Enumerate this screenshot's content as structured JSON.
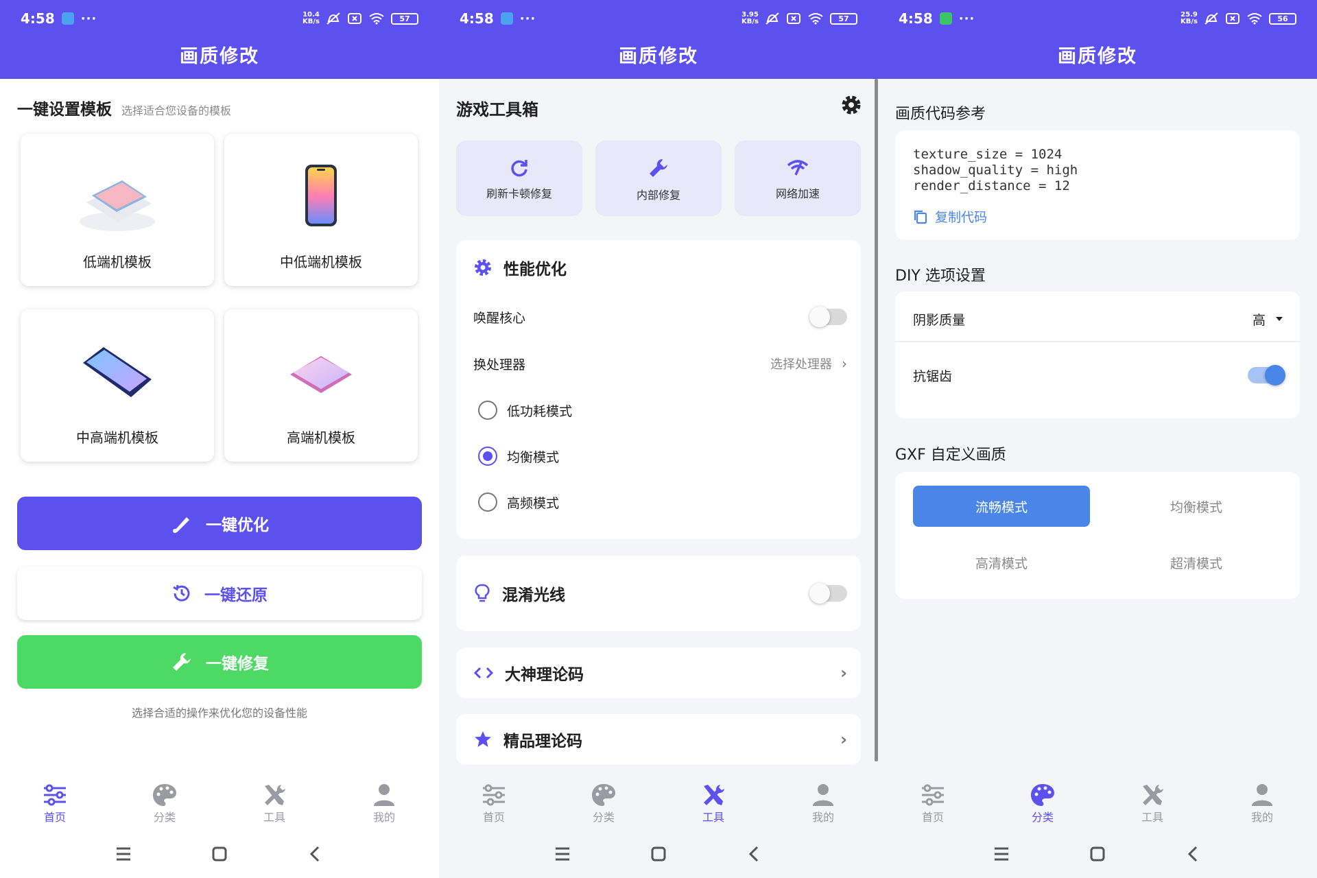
{
  "colors": {
    "primary": "#5c50ef",
    "green": "#4cd964",
    "blue": "#4a86e8"
  },
  "status_bars": [
    {
      "time": "4:58",
      "dots": "···",
      "speed_top": "10.4",
      "speed_bottom": "KB/s",
      "battery": "57"
    },
    {
      "time": "4:58",
      "dots": "···",
      "speed_top": "3.95",
      "speed_bottom": "KB/s",
      "battery": "57"
    },
    {
      "time": "4:58",
      "dots": "···",
      "speed_top": "25.9",
      "speed_bottom": "KB/s",
      "battery": "56"
    }
  ],
  "app_title": "画质修改",
  "home": {
    "section_title": "一键设置模板",
    "section_sub": "选择适合您设备的模板",
    "templates": [
      "低端机模板",
      "中低端机模板",
      "中高端机模板",
      "高端机模板"
    ],
    "optimize_label": "一键优化",
    "restore_label": "一键还原",
    "repair_label": "一键修复",
    "footnote": "选择合适的操作来优化您的设备性能"
  },
  "tools": {
    "title": "游戏工具箱",
    "quick_tools": [
      {
        "label": "刷新卡顿修复",
        "icon": "refresh-icon"
      },
      {
        "label": "内部修复",
        "icon": "wrench-icon"
      },
      {
        "label": "网络加速",
        "icon": "wifi-speed-icon"
      }
    ],
    "perf": {
      "title": "性能优化",
      "wake_core": "唤醒核心",
      "wake_core_on": false,
      "change_cpu": "换处理器",
      "select_cpu": "选择处理器",
      "modes": [
        "低功耗模式",
        "均衡模式",
        "高频模式"
      ],
      "selected_mode": 1
    },
    "light": {
      "label": "混淆光线",
      "on": false
    },
    "master_code": "大神理论码",
    "premium_code": "精品理论码"
  },
  "category": {
    "code_ref_title": "画质代码参考",
    "code_lines": [
      "texture_size = 1024",
      "shadow_quality = high",
      "render_distance = 12"
    ],
    "copy_label": "复制代码",
    "diy_title": "DIY 选项设置",
    "shadow_label": "阴影质量",
    "shadow_value": "高",
    "aa_label": "抗锯齿",
    "aa_on": true,
    "gxf_title": "GXF 自定义画质",
    "gxf_modes": [
      "流畅模式",
      "均衡模式",
      "高清模式",
      "超清模式"
    ],
    "gxf_selected": 0
  },
  "nav": [
    "首页",
    "分类",
    "工具",
    "我的"
  ]
}
